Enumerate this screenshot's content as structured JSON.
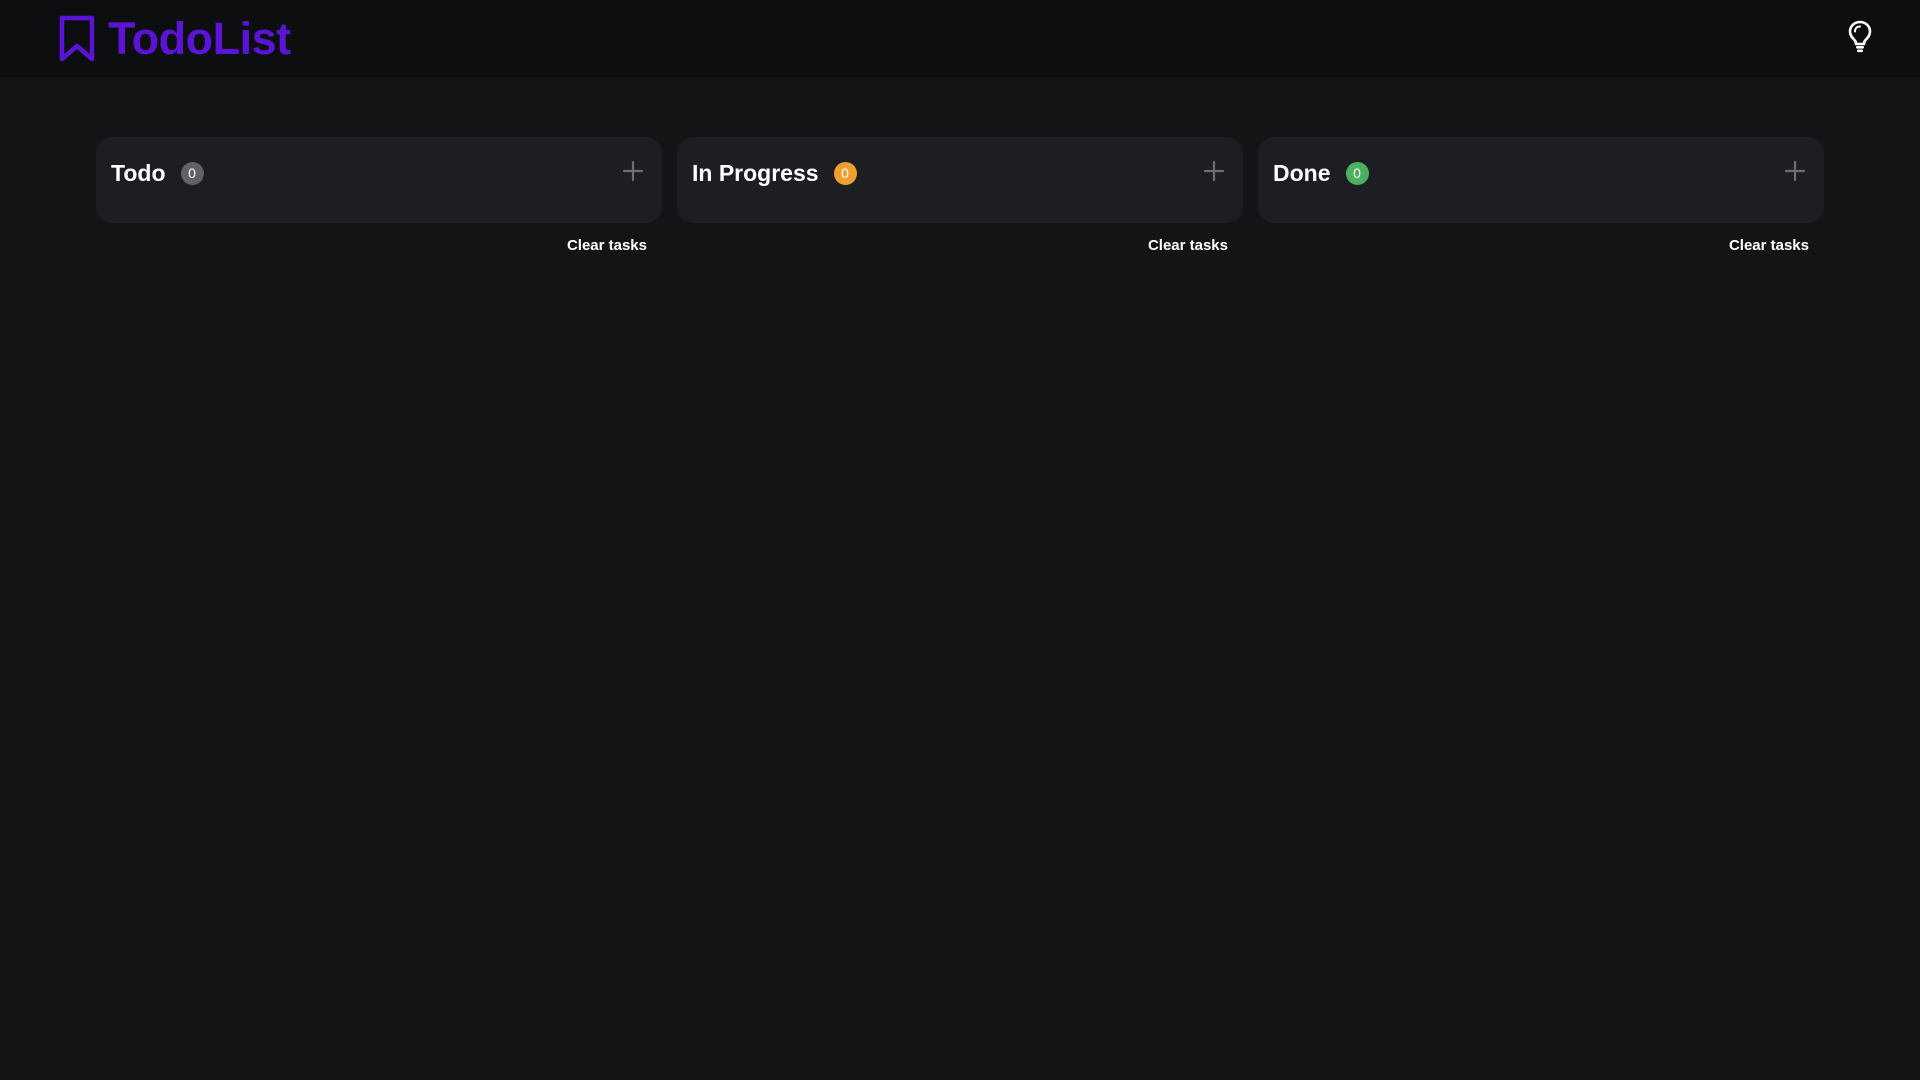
{
  "app": {
    "title": "TodoList",
    "brand_color": "#5b14d6",
    "brand_icon": "bookmark-icon",
    "theme_toggle_icon": "lightbulb-icon"
  },
  "columns": [
    {
      "title": "Todo",
      "count": "0",
      "badge_color": "#606266",
      "add_icon": "plus-icon",
      "clear_label": "Clear tasks"
    },
    {
      "title": "In Progress",
      "count": "0",
      "badge_color": "#f0a030",
      "add_icon": "plus-icon",
      "clear_label": "Clear tasks"
    },
    {
      "title": "Done",
      "count": "0",
      "badge_color": "#4cb060",
      "add_icon": "plus-icon",
      "clear_label": "Clear tasks"
    }
  ]
}
